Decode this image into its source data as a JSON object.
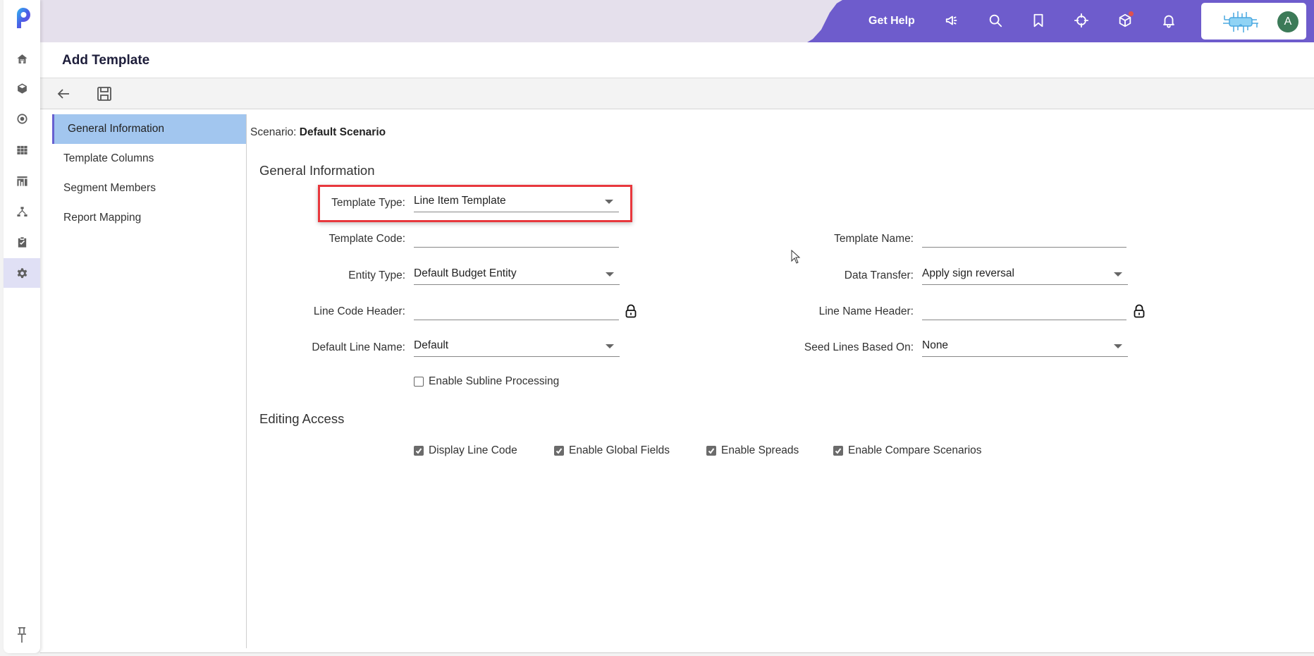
{
  "app": {
    "brand_color": "#6e5ccc",
    "logo": "p-logo",
    "rail_items": [
      {
        "name": "home",
        "icon": "home-icon"
      },
      {
        "name": "modeling",
        "icon": "cube-icon"
      },
      {
        "name": "planning",
        "icon": "target-icon"
      },
      {
        "name": "data",
        "icon": "grid-icon"
      },
      {
        "name": "reports",
        "icon": "report-icon"
      },
      {
        "name": "hierarchy",
        "icon": "hierarchy-icon"
      },
      {
        "name": "tasks",
        "icon": "clipboard-icon"
      },
      {
        "name": "settings",
        "icon": "gear-icon",
        "active": true
      }
    ],
    "pin_icon": "pin-icon"
  },
  "topbar": {
    "get_help": "Get Help",
    "icons": [
      "megaphone-icon",
      "search-icon",
      "bookmark-icon",
      "crosshair-icon",
      "box-icon",
      "bell-icon"
    ],
    "notification_dot_color": "#e0504f",
    "avatar_initial": "A",
    "avatar_color": "#3c7a58"
  },
  "page": {
    "title": "Add Template",
    "toolbar": {
      "back": "back-arrow-icon",
      "save": "save-icon"
    }
  },
  "nav": {
    "items": [
      {
        "label": "General Information",
        "active": true
      },
      {
        "label": "Template Columns"
      },
      {
        "label": "Segment Members"
      },
      {
        "label": "Report Mapping"
      }
    ]
  },
  "scenario": {
    "label": "Scenario:",
    "value": "Default Scenario"
  },
  "general": {
    "title": "General Information",
    "template_type": {
      "label": "Template Type:",
      "value": "Line Item Template"
    },
    "template_code": {
      "label": "Template Code:",
      "value": ""
    },
    "template_name": {
      "label": "Template Name:",
      "value": ""
    },
    "entity_type": {
      "label": "Entity Type:",
      "value": "Default Budget Entity"
    },
    "data_transfer": {
      "label": "Data Transfer:",
      "value": "Apply sign reversal"
    },
    "line_code_header": {
      "label": "Line Code Header:",
      "value": ""
    },
    "line_name_header": {
      "label": "Line Name Header:",
      "value": ""
    },
    "default_line_name": {
      "label": "Default Line Name:",
      "value": "Default"
    },
    "seed_lines": {
      "label": "Seed Lines Based On:",
      "value": "None"
    },
    "subline": {
      "label": "Enable Subline Processing",
      "checked": false
    }
  },
  "editing": {
    "title": "Editing Access",
    "options": [
      {
        "label": "Display Line Code",
        "checked": true
      },
      {
        "label": "Enable Global Fields",
        "checked": true
      },
      {
        "label": "Enable Spreads",
        "checked": true
      },
      {
        "label": "Enable Compare Scenarios",
        "checked": true
      }
    ]
  }
}
